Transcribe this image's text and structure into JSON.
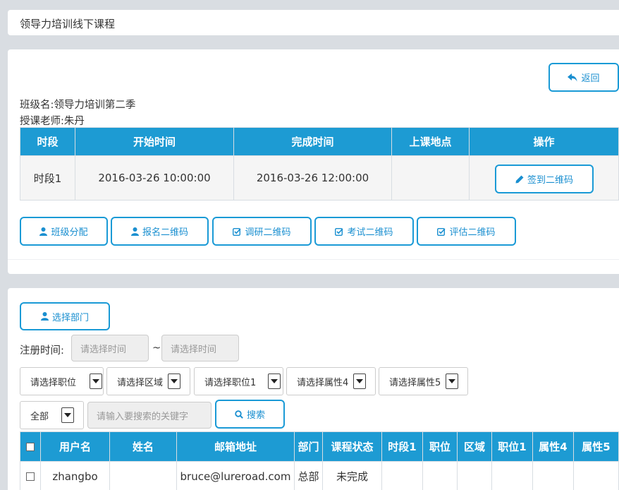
{
  "header": {
    "title": "领导力培训线下课程"
  },
  "class_panel": {
    "back_label": "返回",
    "class_name": "班级名:领导力培训第二季",
    "teacher": "授课老师:朱丹",
    "session_table": {
      "headers": [
        "时段",
        "开始时间",
        "完成时间",
        "上课地点",
        "操作"
      ],
      "rows": [
        {
          "session": "时段1",
          "start": "2016-03-26 10:00:00",
          "end": "2016-03-26 12:00:00",
          "location": "",
          "action_label": "签到二维码"
        }
      ]
    },
    "actions": [
      "班级分配",
      "报名二维码",
      "调研二维码",
      "考试二维码",
      "评估二维码"
    ]
  },
  "filter_panel": {
    "select_dept_label": "选择部门",
    "reg_time_label": "注册时间:",
    "time_start_placeholder": "请选择时间",
    "time_sep": "~",
    "time_end_placeholder": "请选择时间",
    "selects": [
      "请选择职位",
      "请选择区域",
      "请选择职位1",
      "请选择属性4",
      "请选择属性5"
    ],
    "scope_select": "全部",
    "search_placeholder": "请输入要搜索的关键字",
    "search_label": "搜索",
    "user_table": {
      "headers": [
        "用户名",
        "姓名",
        "邮箱地址",
        "部门",
        "课程状态",
        "时段1",
        "职位",
        "区域",
        "职位1",
        "属性4",
        "属性5"
      ],
      "rows": [
        {
          "username": "zhangbo",
          "name": "",
          "email": "bruce@lureroad.com",
          "dept": "总部",
          "status": "未完成",
          "s1": "",
          "pos": "",
          "region": "",
          "pos1": "",
          "attr4": "",
          "attr5": ""
        }
      ]
    }
  },
  "colors": {
    "accent": "#1d9bd3",
    "page_bg": "#d9dde2"
  }
}
